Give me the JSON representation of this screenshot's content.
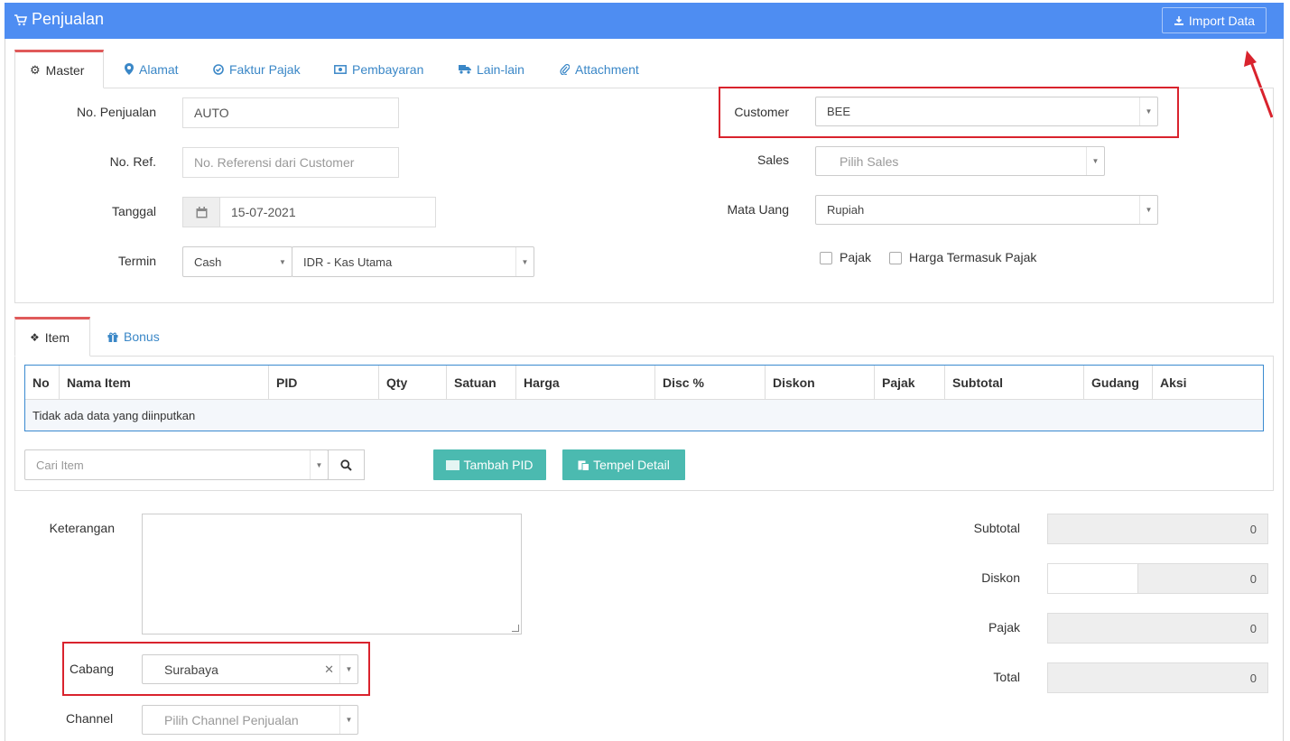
{
  "header": {
    "title": "Penjualan",
    "import_label": "Import Data"
  },
  "tabs": [
    {
      "label": "Master"
    },
    {
      "label": "Alamat"
    },
    {
      "label": "Faktur Pajak"
    },
    {
      "label": "Pembayaran"
    },
    {
      "label": "Lain-lain"
    },
    {
      "label": "Attachment"
    }
  ],
  "master": {
    "no_penjualan_label": "No. Penjualan",
    "no_penjualan_value": "AUTO",
    "no_ref_label": "No. Ref.",
    "no_ref_placeholder": "No. Referensi dari Customer",
    "tanggal_label": "Tanggal",
    "tanggal_value": "15-07-2021",
    "termin_label": "Termin",
    "termin_value": "Cash",
    "kas_value": "IDR - Kas Utama",
    "customer_label": "Customer",
    "customer_value": "BEE",
    "sales_label": "Sales",
    "sales_placeholder": "Pilih Sales",
    "mata_uang_label": "Mata Uang",
    "mata_uang_value": "Rupiah",
    "pajak_label": "Pajak",
    "harga_termasuk_pajak_label": "Harga Termasuk Pajak"
  },
  "item_tabs": [
    {
      "label": "Item"
    },
    {
      "label": "Bonus"
    }
  ],
  "table": {
    "columns": [
      "No",
      "Nama Item",
      "PID",
      "Qty",
      "Satuan",
      "Harga",
      "Disc %",
      "Diskon",
      "Pajak",
      "Subtotal",
      "Gudang",
      "Aksi"
    ],
    "empty_text": "Tidak ada data yang diinputkan"
  },
  "item_search": {
    "placeholder": "Cari Item",
    "tambah_pid_label": "Tambah PID",
    "tempel_detail_label": "Tempel Detail"
  },
  "footer": {
    "keterangan_label": "Keterangan",
    "cabang_label": "Cabang",
    "cabang_value": "Surabaya",
    "channel_label": "Channel",
    "channel_placeholder": "Pilih Channel Penjualan",
    "subtotal_label": "Subtotal",
    "subtotal_value": "0",
    "diskon_label": "Diskon",
    "diskon_value": "0",
    "pajak_label": "Pajak",
    "pajak_value": "0",
    "total_label": "Total",
    "total_value": "0"
  },
  "colors": {
    "header": "#4e8df2",
    "accent_link": "#3a87c7",
    "teal_button": "#4bbab0",
    "highlight_red": "#d9232d"
  }
}
